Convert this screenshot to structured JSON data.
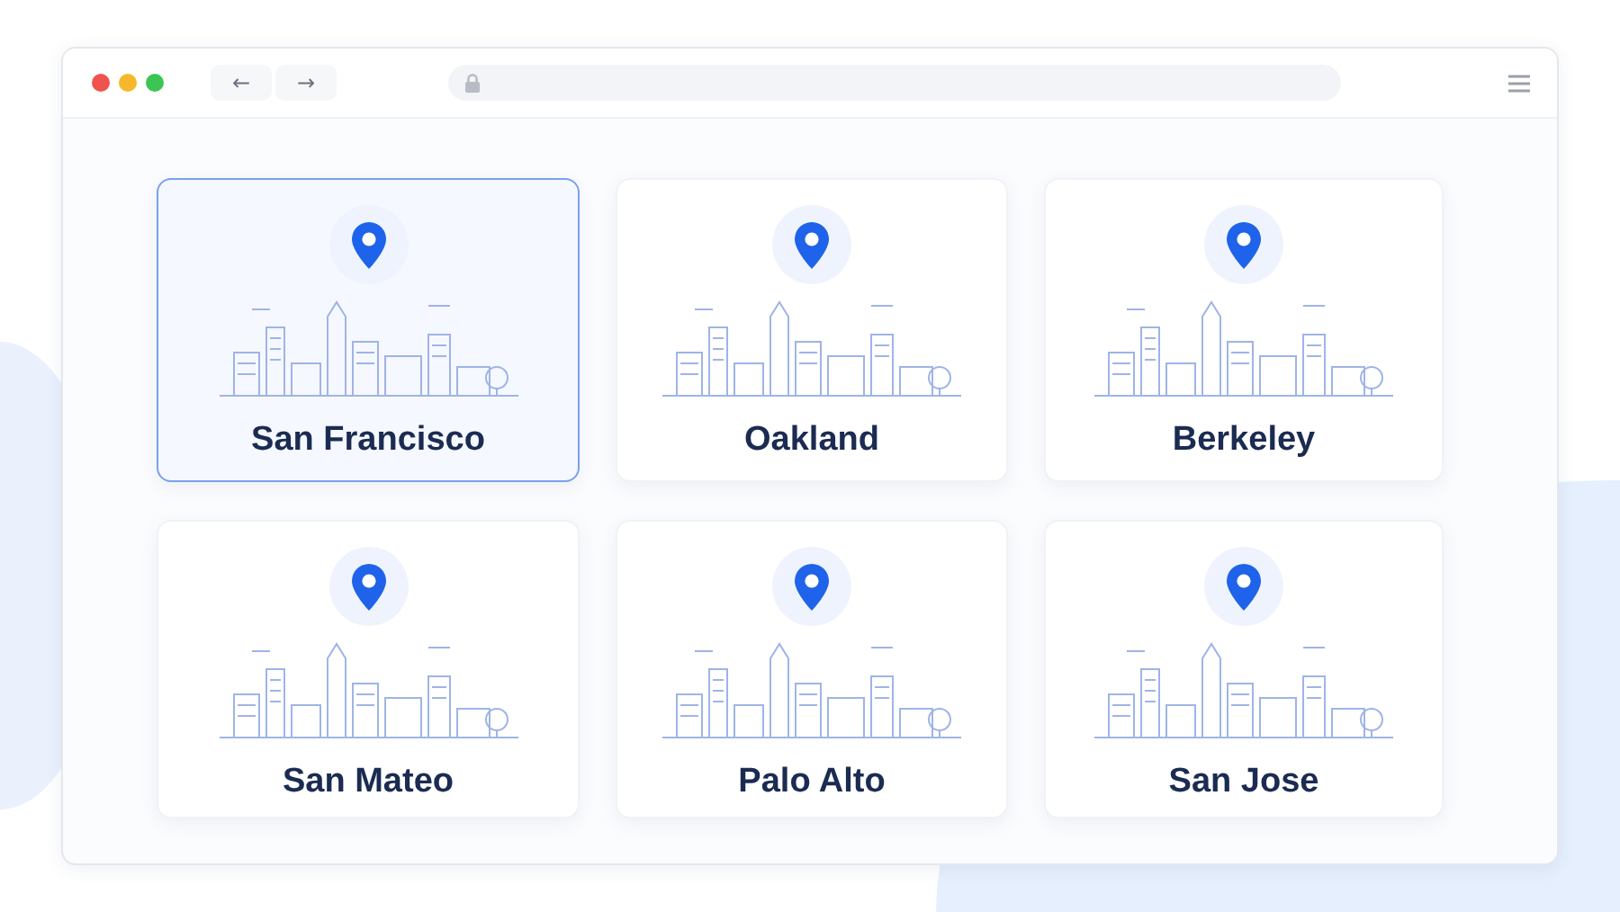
{
  "browser": {
    "nav_buttons": [
      "←",
      "→"
    ]
  },
  "cities": [
    {
      "name": "San Francisco",
      "selected": true
    },
    {
      "name": "Oakland",
      "selected": false
    },
    {
      "name": "Berkeley",
      "selected": false
    },
    {
      "name": "San Mateo",
      "selected": false
    },
    {
      "name": "Palo Alto",
      "selected": false
    },
    {
      "name": "San Jose",
      "selected": false
    }
  ]
}
